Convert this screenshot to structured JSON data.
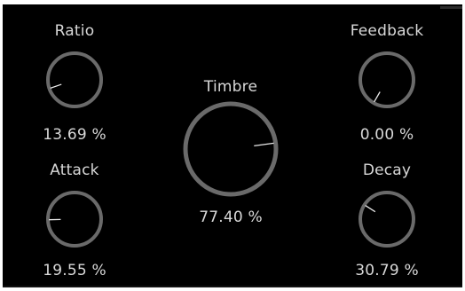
{
  "knobs": [
    {
      "id": "ratio",
      "label": "Ratio",
      "value_text": "13.69 %",
      "value": 0.1369
    },
    {
      "id": "feedback",
      "label": "Feedback",
      "value_text": "0.00 %",
      "value": 0.0
    },
    {
      "id": "timbre",
      "label": "Timbre",
      "value_text": "77.40 %",
      "value": 0.774
    },
    {
      "id": "attack",
      "label": "Attack",
      "value_text": "19.55 %",
      "value": 0.1955
    },
    {
      "id": "decay",
      "label": "Decay",
      "value_text": "30.79 %",
      "value": 0.3079
    }
  ],
  "colors": {
    "background": "#000000",
    "ring": "#6a6a6a",
    "pointer": "#e8e8e8",
    "text": "#d8d8d8"
  }
}
